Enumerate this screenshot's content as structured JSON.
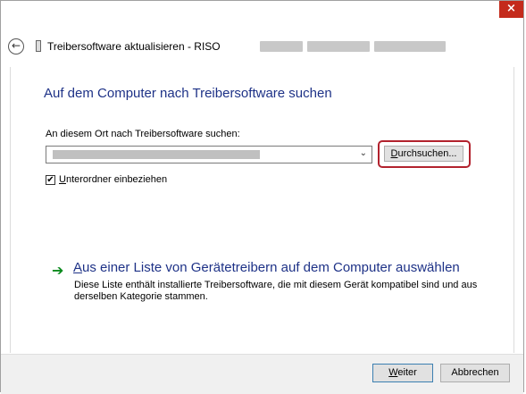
{
  "window": {
    "close_glyph": "×"
  },
  "header": {
    "back_glyph": "←",
    "title": "Treibersoftware aktualisieren - RISO"
  },
  "main": {
    "heading": "Auf dem Computer nach Treibersoftware suchen",
    "path_label": "An diesem Ort nach Treibersoftware suchen:",
    "path_value": "",
    "combo_arrow": "⌄",
    "browse_label_first": "D",
    "browse_label_rest": "urchsuchen...",
    "include_subfolders": {
      "checked": true,
      "check_glyph": "✔",
      "label_first": "U",
      "label_rest": "nterordner einbeziehen"
    },
    "pick_option": {
      "arrow_glyph": "➔",
      "title_first": "A",
      "title_rest": "us einer Liste von Gerätetreibern auf dem Computer auswählen",
      "description": "Diese Liste enthält installierte Treibersoftware, die mit diesem Gerät kompatibel sind und aus derselben Kategorie stammen."
    }
  },
  "footer": {
    "next_first": "W",
    "next_rest": "eiter",
    "cancel": "Abbrechen"
  },
  "colors": {
    "heading": "#1e3287",
    "highlight_ring": "#b2222e",
    "close_bg": "#c42b1c",
    "arrow_green": "#0a8a1d"
  }
}
